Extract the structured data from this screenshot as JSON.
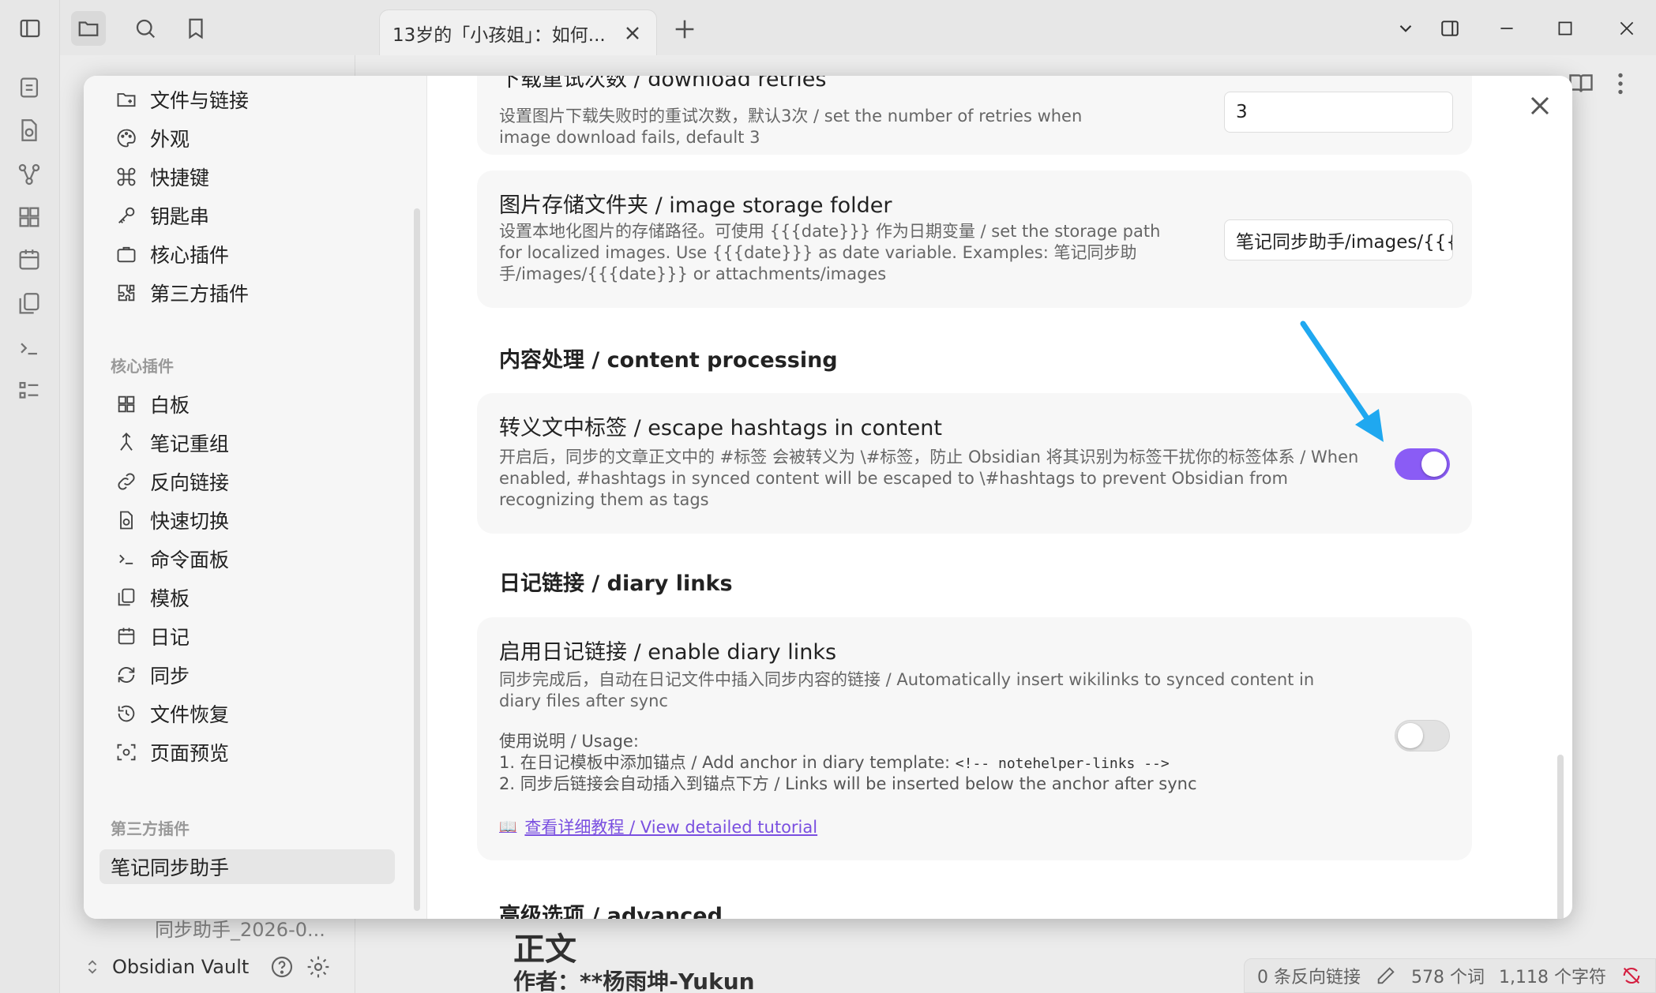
{
  "tab": {
    "title": "13岁的「小孩姐」：如何..."
  },
  "vault": {
    "name": "Obsidian Vault"
  },
  "background": {
    "file_item": "同步助手_2026-0...",
    "body_title": "正文",
    "body_author": "作者：**杨雨坤-Yukun"
  },
  "status": {
    "backlinks": "0 条反向链接",
    "words": "578 个词",
    "chars": "1,118 个字符"
  },
  "nav": {
    "top_items": [
      {
        "label": "文件与链接",
        "icon": "folder-link-icon"
      },
      {
        "label": "外观",
        "icon": "palette-icon"
      },
      {
        "label": "快捷键",
        "icon": "command-icon"
      },
      {
        "label": "钥匙串",
        "icon": "key-icon"
      },
      {
        "label": "核心插件",
        "icon": "briefcase-icon"
      },
      {
        "label": "第三方插件",
        "icon": "puzzle-icon"
      }
    ],
    "core_heading": "核心插件",
    "core_items": [
      {
        "label": "白板",
        "icon": "canvas-icon"
      },
      {
        "label": "笔记重组",
        "icon": "merge-icon"
      },
      {
        "label": "反向链接",
        "icon": "backlink-icon"
      },
      {
        "label": "快速切换",
        "icon": "file-search-icon"
      },
      {
        "label": "命令面板",
        "icon": "terminal-icon"
      },
      {
        "label": "模板",
        "icon": "copy-icon"
      },
      {
        "label": "日记",
        "icon": "calendar-icon"
      },
      {
        "label": "同步",
        "icon": "sync-icon"
      },
      {
        "label": "文件恢复",
        "icon": "history-icon"
      },
      {
        "label": "页面预览",
        "icon": "preview-icon"
      }
    ],
    "community_heading": "第三方插件",
    "community_items": [
      {
        "label": "笔记同步助手"
      }
    ]
  },
  "settings": {
    "retries": {
      "name": "下载重试次数 / download retries",
      "desc": "设置图片下载失败时的重试次数，默认3次 / set the number of retries when image download fails, default 3",
      "value": "3"
    },
    "storage": {
      "name": "图片存储文件夹 / image storage folder",
      "desc": "设置本地化图片的存储路径。可使用 {{{date}}} 作为日期变量 / set the storage path for localized images. Use {{{date}}} as date variable. Examples: 笔记同步助手/images/{{{date}}} or attachments/images",
      "value": "笔记同步助手/images/{{{date}}}"
    },
    "content_section": "内容处理 / content processing",
    "escape": {
      "name": "转义文中标签 / escape hashtags in content",
      "desc": "开启后，同步的文章正文中的 #标签 会被转义为 \\#标签，防止 Obsidian 将其识别为标签干扰你的标签体系 / When enabled, #hashtags in synced content will be escaped to \\#hashtags to prevent Obsidian from recognizing them as tags",
      "enabled": true
    },
    "diary_section": "日记链接 / diary links",
    "diary": {
      "name": "启用日记链接 / enable diary links",
      "desc": "同步完成后，自动在日记文件中插入同步内容的链接 / Automatically insert wikilinks to synced content in diary files after sync",
      "usage_title": "使用说明 / Usage:",
      "usage_1": "1. 在日记模板中添加锚点 / Add anchor in diary template: ",
      "usage_1_code": "<!-- notehelper-links -->",
      "usage_2": "2. 同步后链接会自动插入到锚点下方 / Links will be inserted below the anchor after sync",
      "tutorial_icon": "📖",
      "tutorial": "查看详细教程 / View detailed tutorial",
      "enabled": false
    },
    "advanced_section": "高级选项 / advanced"
  },
  "colors": {
    "accent": "#8a5cf5",
    "arrow": "#1fa8f0"
  }
}
